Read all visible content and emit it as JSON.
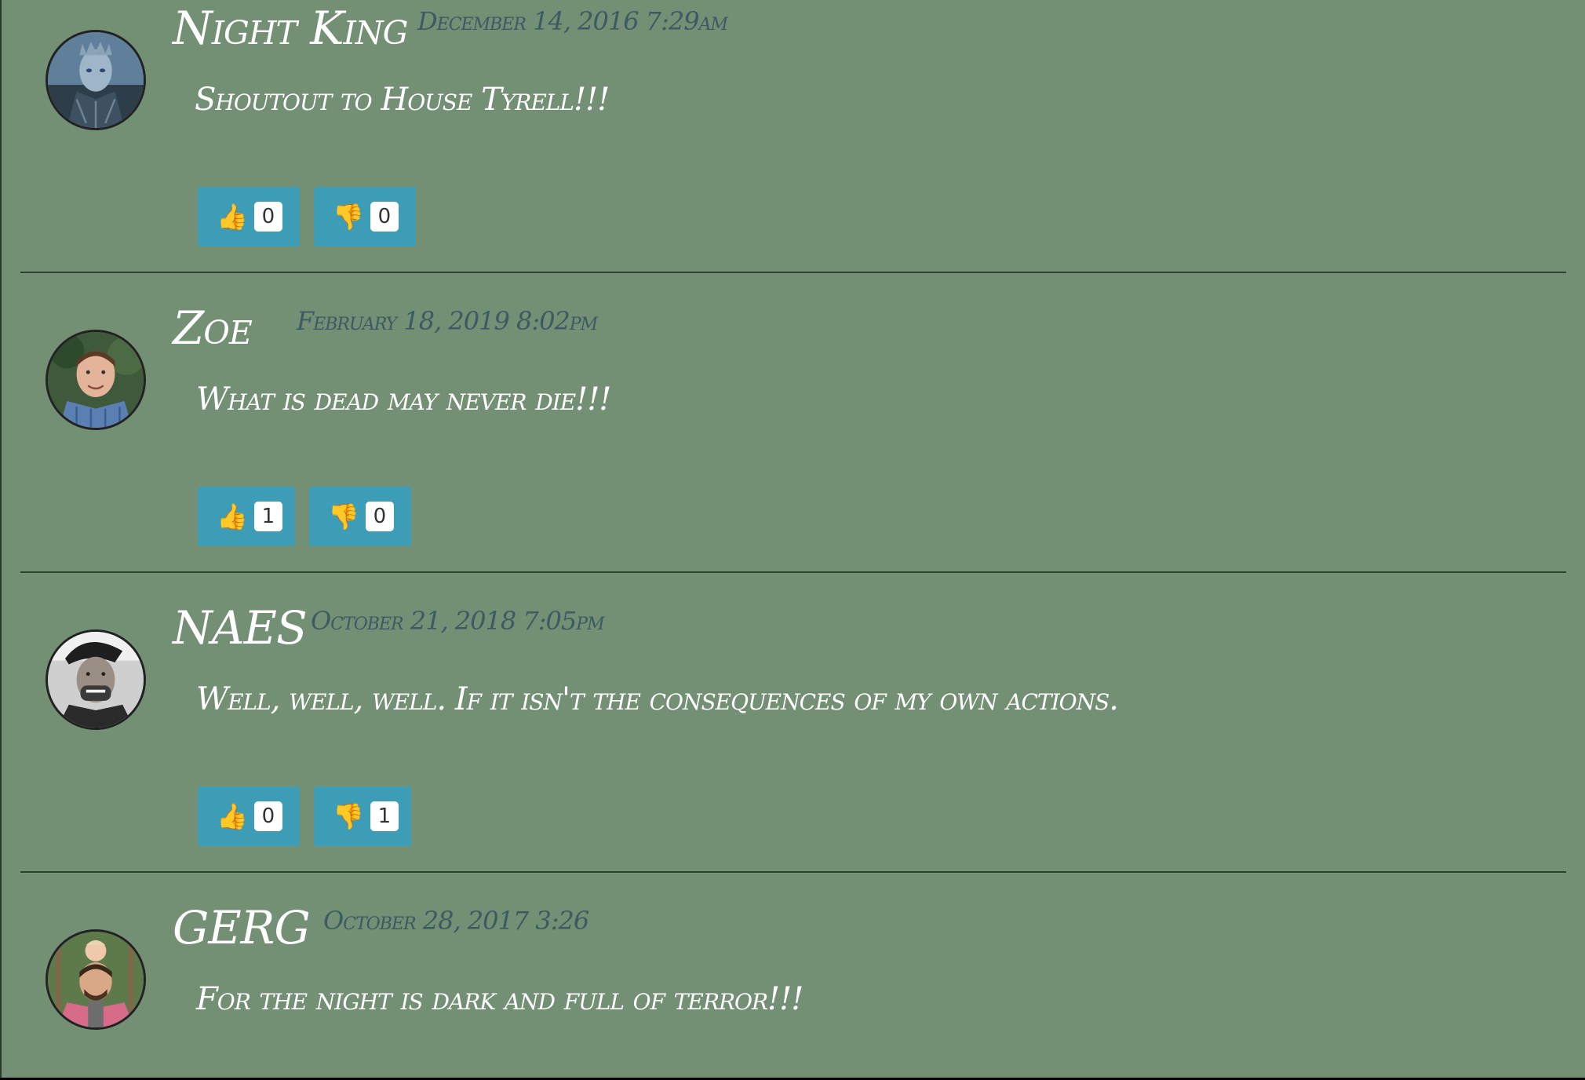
{
  "comments": [
    {
      "username": "Night King",
      "timestamp": "December 14, 2016 7:29am",
      "text": "Shoutout to House Tyrell!!!",
      "avatar": "night-king-avatar",
      "likes": "0",
      "dislikes": "0"
    },
    {
      "username": "Zoe",
      "timestamp": "February 18, 2019 8:02pm",
      "text": "What is dead may never die!!!",
      "avatar": "zoe-avatar",
      "likes": "1",
      "dislikes": "0"
    },
    {
      "username": "NAES",
      "timestamp": "October 21, 2018 7:05pm",
      "text": "Well, well, well. If it isn't the consequences of my own actions.",
      "avatar": "naes-avatar",
      "likes": "0",
      "dislikes": "1"
    },
    {
      "username": "GERG",
      "timestamp": "October 28, 2017 3:26",
      "text": "For the night is dark and full of terror!!!",
      "avatar": "gerg-avatar"
    }
  ],
  "icons": {
    "like": "thumbs-up-icon",
    "dislike": "thumbs-down-icon"
  },
  "colors": {
    "background": "#738f74",
    "button": "#3d9db6",
    "timestamp": "#3c5a63",
    "text": "#ffffff"
  }
}
